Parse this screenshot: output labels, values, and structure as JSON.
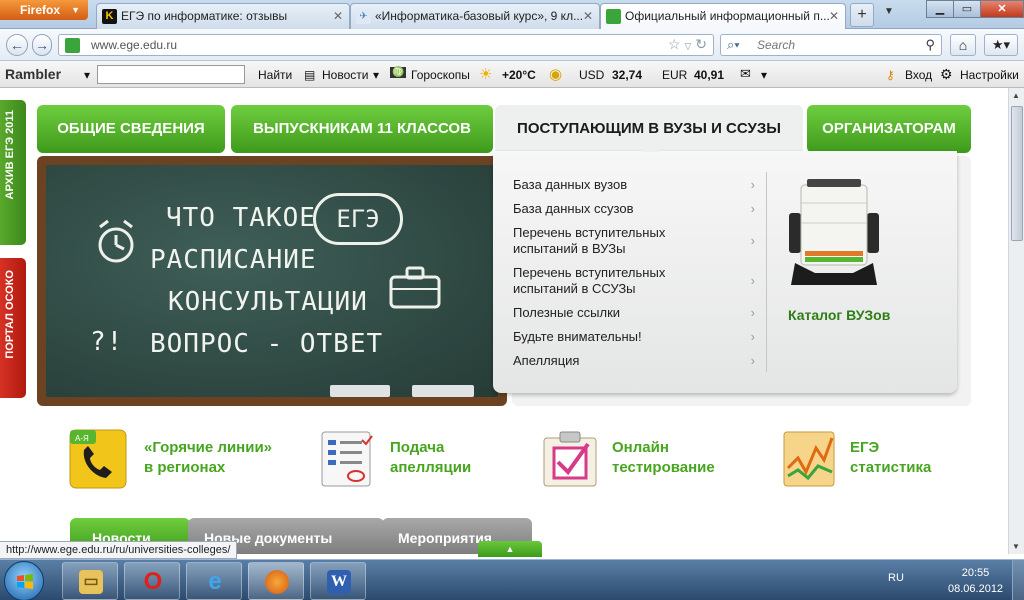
{
  "browser": {
    "app_button": "Firefox",
    "tabs": [
      {
        "title": "ЕГЭ по информатике: отзывы",
        "favicon_color": "#111111"
      },
      {
        "title": "«Информатика-базовый курс», 9 кл...",
        "favicon_color": "#5b8fd0"
      },
      {
        "title": "Официальный информационный п...",
        "favicon_color": "#3aa53a"
      }
    ],
    "url": "www.ege.edu.ru",
    "search_placeholder": "Search"
  },
  "rambler": {
    "logo": "Rambler",
    "find": "Найти",
    "news": "Новости",
    "horoscope": "Гороскопы",
    "weather": "+20°C",
    "usd_label": "USD",
    "usd_value": "32,74",
    "eur_label": "EUR",
    "eur_value": "40,91",
    "login": "Вход",
    "settings": "Настройки"
  },
  "sidebar": {
    "archive": "АРХИВ ЕГЭ 2011",
    "portal": "ПОРТАЛ ОСОКО"
  },
  "mainnav": [
    {
      "label": "ОБЩИЕ СВЕДЕНИЯ"
    },
    {
      "label": "ВЫПУСКНИКАМ 11 КЛАССОВ"
    },
    {
      "label": "ПОСТУПАЮЩИМ В ВУЗЫ И ССУЗЫ"
    },
    {
      "label": "ОРГАНИЗАТОРАМ"
    }
  ],
  "chalkboard": {
    "line1": "ЧТО ТАКОЕ",
    "ege": "ЕГЭ",
    "line2": "РАСПИСАНИЕ",
    "line3": "КОНСУЛЬТАЦИИ",
    "line4": "ВОПРОС - ОТВЕТ"
  },
  "dropdown": {
    "items": [
      {
        "label": "База данных вузов"
      },
      {
        "label": "База данных ссузов"
      },
      {
        "label": "Перечень вступительных\nиспытаний в ВУЗы"
      },
      {
        "label": "Перечень вступительных\nиспытаний в ССУЗы"
      },
      {
        "label": "Полезные ссылки"
      },
      {
        "label": "Будьте внимательны!"
      },
      {
        "label": "Апелляция"
      }
    ],
    "catalog_title": "Каталог ВУЗов"
  },
  "features": [
    {
      "label": "«Горячие линии»\nв регионах",
      "icon": "phone-icon"
    },
    {
      "label": "Подача\nапелляции",
      "icon": "form-icon"
    },
    {
      "label": "Онлайн\nтестирование",
      "icon": "checkbox-icon"
    },
    {
      "label": "ЕГЭ\nстатистика",
      "icon": "chart-icon"
    }
  ],
  "bottom_tabs": [
    {
      "label": "Новости"
    },
    {
      "label": "Новые документы"
    },
    {
      "label": "Мероприятия"
    }
  ],
  "status_url": "http://www.ege.edu.ru/ru/universities-colleges/",
  "taskbar": {
    "lang": "RU",
    "time": "20:55",
    "date": "08.06.2012"
  },
  "colors": {
    "nav_green": "#4fae25",
    "accent_green": "#47a520",
    "portal_red": "#c7241a",
    "chalkboard": "#2f4a44"
  }
}
